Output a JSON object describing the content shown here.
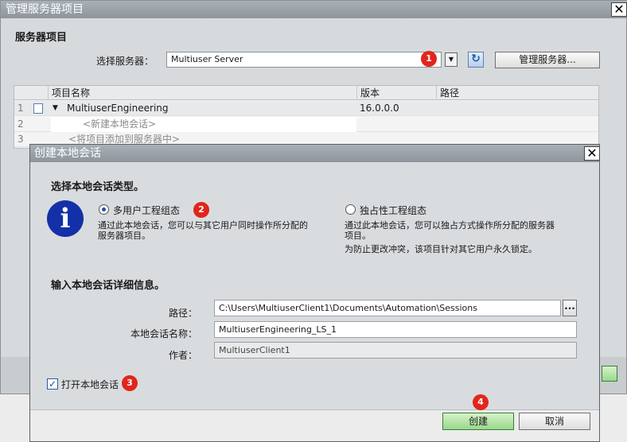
{
  "outer": {
    "title": "管理服务器项目",
    "close": "✕",
    "section_title": "服务器项目",
    "select_label": "选择服务器：",
    "server_value": "Multiuser Server",
    "manage_button": "管理服务器...",
    "refresh_icon": "refresh-icon",
    "table": {
      "headers": [
        "项目名称",
        "版本",
        "路径"
      ],
      "rows": [
        {
          "num": "1",
          "name": "MultiuserEngineering",
          "version": "16.0.0.0",
          "path": ""
        },
        {
          "num": "2",
          "name": "<新建本地会话>",
          "version": "",
          "path": ""
        },
        {
          "num": "3",
          "name": "<将项目添加到服务器中>",
          "version": "",
          "path": ""
        }
      ]
    }
  },
  "dialog": {
    "title": "创建本地会话",
    "close": "✕",
    "type_heading": "选择本地会话类型。",
    "option_multiuser": {
      "label": "多用户工程组态",
      "selected": true,
      "desc1": "通过此本地会话，您可以与其它用户同时操作所分配的",
      "desc2": "服务器项目。"
    },
    "option_exclusive": {
      "label": "独占性工程组态",
      "selected": false,
      "desc1": "通过此本地会话，您可以独占方式操作所分配的服务器",
      "desc2": "项目。",
      "desc3": "为防止更改冲突，该项目针对其它用户永久锁定。"
    },
    "details_heading": "输入本地会话详细信息。",
    "path_label": "路径：",
    "path_value": "C:\\Users\\MultiuserClient1\\Documents\\Automation\\Sessions",
    "browse": "...",
    "name_label": "本地会话名称：",
    "name_value": "MultiuserEngineering_LS_1",
    "author_label": "作者：",
    "author_value": "MultiuserClient1",
    "open_label": "打开本地会话",
    "open_checked": true,
    "create_button": "创建",
    "cancel_button": "取消"
  },
  "badges": [
    "1",
    "2",
    "3",
    "4"
  ],
  "colors": {
    "badge": "#e1261c",
    "info_icon": "#1330a8",
    "primary_button": "#98d88a"
  }
}
